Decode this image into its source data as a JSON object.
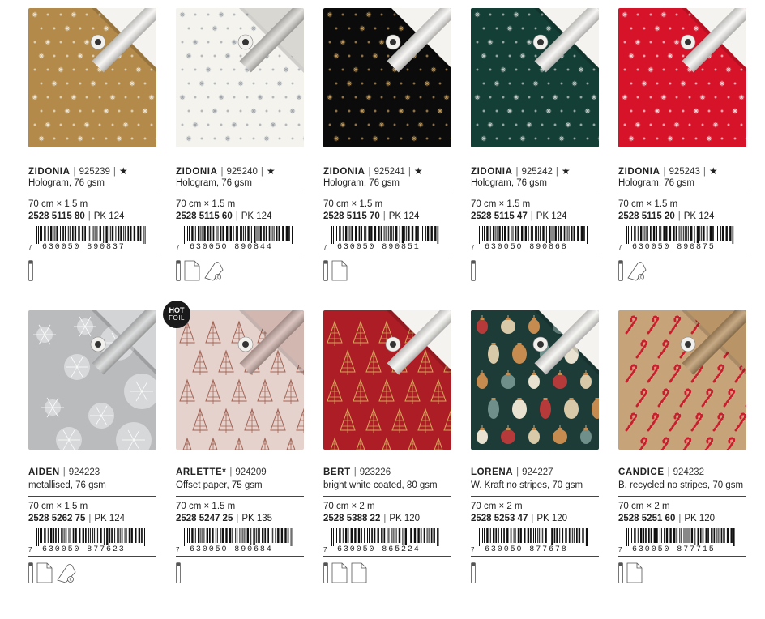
{
  "products": [
    {
      "name": "ZIDONIA",
      "code": "925239",
      "star": "★",
      "material": "Hologram, 76 gsm",
      "size": "70 cm × 1.5 m",
      "sku": "2528 5115 80",
      "pack": "PK 124",
      "barcode_first": "7",
      "barcode_digits": "630050 890837",
      "hot_foil": false,
      "icons": [
        "tube-icon"
      ],
      "colors": {
        "bg": "#b38a4a",
        "motif": "#f2eee0",
        "back": "#f4f3f0"
      }
    },
    {
      "name": "ZIDONIA",
      "code": "925240",
      "star": "★",
      "material": "Hologram, 76 gsm",
      "size": "70 cm × 1.5 m",
      "sku": "2528 5115 60",
      "pack": "PK 124",
      "barcode_first": "7",
      "barcode_digits": "630050 890844",
      "hot_foil": false,
      "icons": [
        "tube-icon",
        "flat-sheet-icon",
        "roll-icon"
      ],
      "colors": {
        "bg": "#f4f3ee",
        "motif": "#9aa0a6",
        "back": "#d9d7d2"
      }
    },
    {
      "name": "ZIDONIA",
      "code": "925241",
      "star": "★",
      "material": "Hologram, 76 gsm",
      "size": "70 cm × 1.5 m",
      "sku": "2528 5115 70",
      "pack": "PK 124",
      "barcode_first": "7",
      "barcode_digits": "630050 890851",
      "hot_foil": false,
      "icons": [
        "tube-icon",
        "flat-sheet-icon"
      ],
      "colors": {
        "bg": "#0b0b0b",
        "motif": "#c9a060",
        "back": "#f4f3f0"
      }
    },
    {
      "name": "ZIDONIA",
      "code": "925242",
      "star": "★",
      "material": "Hologram, 76 gsm",
      "size": "70 cm × 1.5 m",
      "sku": "2528 5115 47",
      "pack": "PK 124",
      "barcode_first": "7",
      "barcode_digits": "630050 890868",
      "hot_foil": false,
      "icons": [
        "tube-icon"
      ],
      "colors": {
        "bg": "#143f36",
        "motif": "#cfd6d2",
        "back": "#f4f3f0"
      }
    },
    {
      "name": "ZIDONIA",
      "code": "925243",
      "star": "★",
      "material": "Hologram, 76 gsm",
      "size": "70 cm × 1.5 m",
      "sku": "2528 5115 20",
      "pack": "PK 124",
      "barcode_first": "7",
      "barcode_digits": "630050 890875",
      "hot_foil": false,
      "icons": [
        "tube-icon",
        "roll-icon"
      ],
      "colors": {
        "bg": "#d7132a",
        "motif": "#f6e6e6",
        "back": "#f4f3f0"
      }
    },
    {
      "name": "AIDEN",
      "code": "924223",
      "star": "",
      "material": "metallised, 76 gsm",
      "size": "70 cm × 1.5 m",
      "sku": "2528 5262 75",
      "pack": "PK 124",
      "barcode_first": "7",
      "barcode_digits": "630050 877623",
      "hot_foil": false,
      "icons": [
        "tube-icon",
        "flat-sheet-icon",
        "roll-icon"
      ],
      "colors": {
        "bg": "#b9bbbd",
        "motif": "#eef0f1",
        "back": "#d3d4d5"
      }
    },
    {
      "name": "ARLETTE*",
      "code": "924209",
      "star": "",
      "material": "Offset paper, 75 gsm",
      "size": "70 cm × 1.5 m",
      "sku": "2528 5247 25",
      "pack": "PK 135",
      "barcode_first": "7",
      "barcode_digits": "630050 890684",
      "hot_foil": true,
      "hot_label": "HOT",
      "foil_label": "FOIL",
      "icons": [
        "tube-icon"
      ],
      "colors": {
        "bg": "#e6d2cd",
        "motif": "#a26455",
        "back": "#d2b6b0"
      }
    },
    {
      "name": "BERT",
      "code": "923226",
      "star": "",
      "material": "bright white coated, 80 gsm",
      "size": "70 cm × 2 m",
      "sku": "2528 5388 22",
      "pack": "PK 120",
      "barcode_first": "7",
      "barcode_digits": "630050 865224",
      "hot_foil": false,
      "icons": [
        "tube-icon",
        "flat-sheet-icon",
        "flat-sheet-icon"
      ],
      "colors": {
        "bg": "#ad1d25",
        "motif": "#d6a85c",
        "back": "#f4f3f0"
      }
    },
    {
      "name": "LORENA",
      "code": "924227",
      "star": "",
      "material": "W. Kraft no stripes, 70 gsm",
      "size": "70 cm × 2 m",
      "sku": "2528 5253 47",
      "pack": "PK 120",
      "barcode_first": "7",
      "barcode_digits": "630050 877678",
      "hot_foil": false,
      "icons": [
        "tube-icon"
      ],
      "colors": {
        "bg": "#1d3c38",
        "motif": "#c58b4f",
        "back": "#f4f3f0"
      }
    },
    {
      "name": "CANDICE",
      "code": "924232",
      "star": "",
      "material": "B. recycled no stripes, 70 gsm",
      "size": "70 cm × 2 m",
      "sku": "2528 5251 60",
      "pack": "PK 120",
      "barcode_first": "7",
      "barcode_digits": "630050 877715",
      "hot_foil": false,
      "icons": [
        "tube-icon",
        "flat-sheet-icon"
      ],
      "colors": {
        "bg": "#c6a378",
        "motif": "#c8202a",
        "back": "#b89466"
      }
    }
  ]
}
